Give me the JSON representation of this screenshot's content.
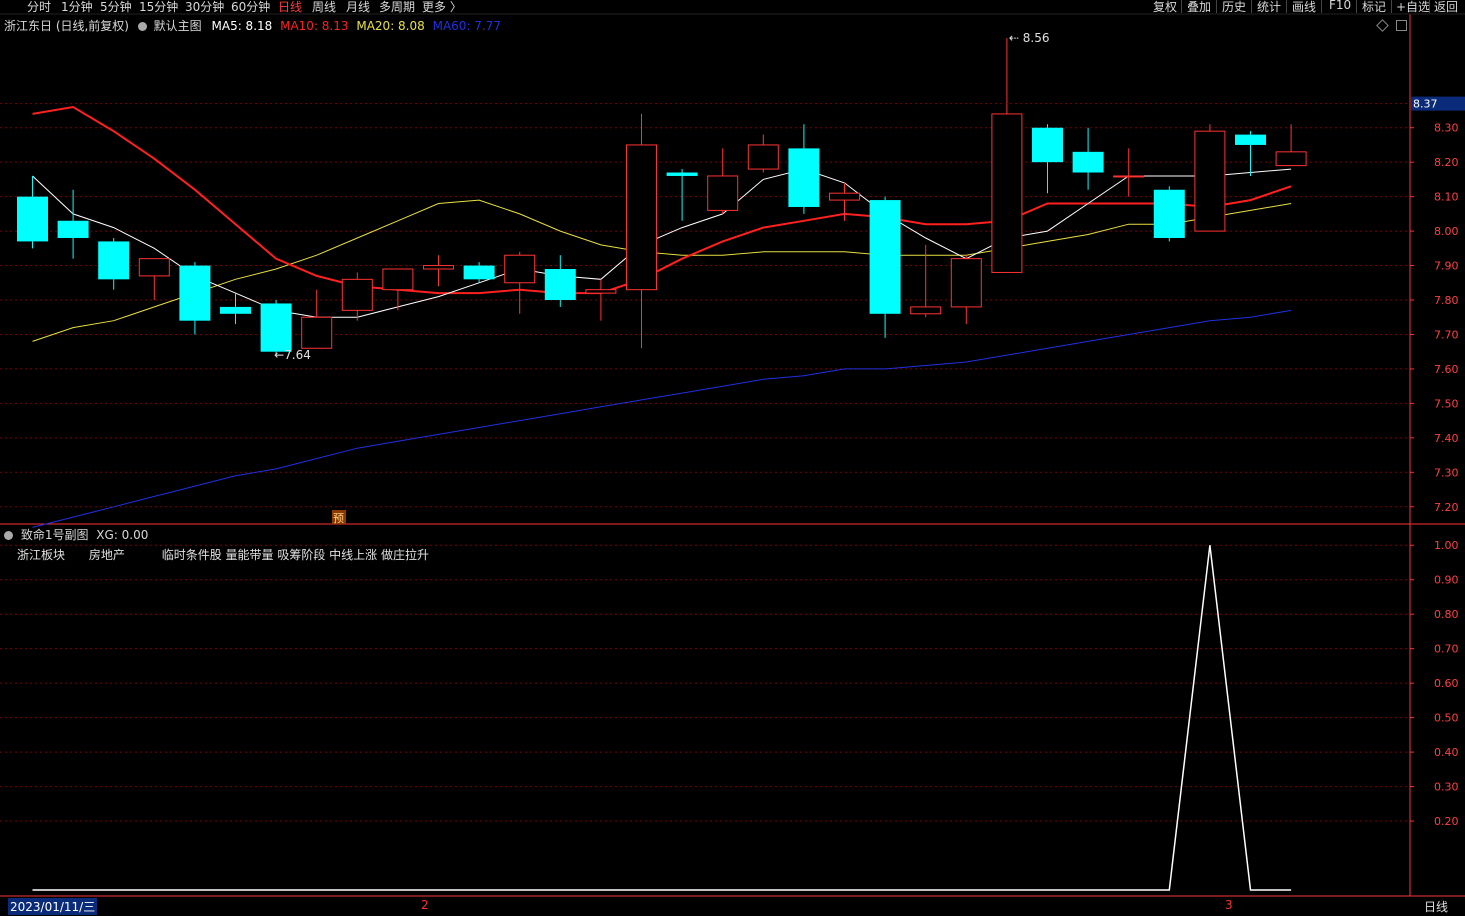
{
  "toolbar": {
    "periods": [
      "分时",
      "1分钟",
      "5分钟",
      "15分钟",
      "30分钟",
      "60分钟",
      "日线",
      "周线",
      "月线",
      "多周期",
      "更多 〉"
    ],
    "active_period": "日线",
    "right_buttons": [
      "复权",
      "叠加",
      "历史",
      "统计",
      "画线",
      "F10",
      "标记",
      "+自选",
      "返回"
    ]
  },
  "main_panel": {
    "title": "浙江东日 (日线,前复权)",
    "template": "默认主图",
    "ma": [
      {
        "label": "MA5: 8.18",
        "color": "#ffffff"
      },
      {
        "label": "MA10: 8.13",
        "color": "#ff2020"
      },
      {
        "label": "MA20: 8.08",
        "color": "#e8e040"
      },
      {
        "label": "MA60: 7.77",
        "color": "#2030e0"
      }
    ],
    "price_tag": "8.37",
    "max_label": "8.56",
    "min_label": "7.64",
    "forecast_marker": "预"
  },
  "sub_panel": {
    "title": "致命1号副图",
    "xg_label": "XG: 0.00",
    "sector1": "浙江板块",
    "sector2": "房地产",
    "tags": "临时条件股 量能带量 吸筹阶段 中线上涨 做庄拉升"
  },
  "bottom": {
    "date": "2023/01/11/三",
    "month_2": "2",
    "month_3": "3",
    "period_label": "日线"
  },
  "colors": {
    "up": "#ff3232",
    "down": "#00ffff",
    "grid": "#7a0000",
    "axis": "#ff3232",
    "ma5": "#ffffff",
    "ma10": "#ff2020",
    "ma20": "#e8e040",
    "ma60": "#2030e0"
  },
  "chart_data": {
    "type": "candlestick",
    "ylim": [
      7.15,
      8.63
    ],
    "yticks": [
      7.2,
      7.3,
      7.4,
      7.5,
      7.6,
      7.7,
      7.8,
      7.9,
      8.0,
      8.1,
      8.2,
      8.3
    ],
    "candles": [
      {
        "o": 8.1,
        "h": 8.16,
        "l": 7.95,
        "c": 7.97
      },
      {
        "o": 8.03,
        "h": 8.12,
        "l": 7.92,
        "c": 7.98
      },
      {
        "o": 7.97,
        "h": 7.98,
        "l": 7.83,
        "c": 7.86
      },
      {
        "o": 7.87,
        "h": 7.92,
        "l": 7.8,
        "c": 7.92
      },
      {
        "o": 7.9,
        "h": 7.91,
        "l": 7.7,
        "c": 7.74
      },
      {
        "o": 7.78,
        "h": 7.82,
        "l": 7.73,
        "c": 7.76
      },
      {
        "o": 7.79,
        "h": 7.8,
        "l": 7.64,
        "c": 7.65
      },
      {
        "o": 7.66,
        "h": 7.83,
        "l": 7.66,
        "c": 7.75
      },
      {
        "o": 7.77,
        "h": 7.88,
        "l": 7.74,
        "c": 7.86
      },
      {
        "o": 7.83,
        "h": 7.89,
        "l": 7.77,
        "c": 7.89
      },
      {
        "o": 7.89,
        "h": 7.93,
        "l": 7.84,
        "c": 7.9
      },
      {
        "o": 7.9,
        "h": 7.91,
        "l": 7.85,
        "c": 7.86
      },
      {
        "o": 7.85,
        "h": 7.94,
        "l": 7.76,
        "c": 7.93
      },
      {
        "o": 7.89,
        "h": 7.93,
        "l": 7.78,
        "c": 7.8
      },
      {
        "o": 7.82,
        "h": 7.86,
        "l": 7.74,
        "c": 7.83
      },
      {
        "o": 7.83,
        "h": 8.34,
        "l": 7.66,
        "c": 8.25
      },
      {
        "o": 8.17,
        "h": 8.18,
        "l": 8.03,
        "c": 8.16
      },
      {
        "o": 8.06,
        "h": 8.24,
        "l": 8.05,
        "c": 8.16
      },
      {
        "o": 8.18,
        "h": 8.28,
        "l": 8.17,
        "c": 8.25
      },
      {
        "o": 8.24,
        "h": 8.31,
        "l": 8.05,
        "c": 8.07
      },
      {
        "o": 8.09,
        "h": 8.14,
        "l": 8.03,
        "c": 8.11
      },
      {
        "o": 8.09,
        "h": 8.1,
        "l": 7.69,
        "c": 7.76
      },
      {
        "o": 7.76,
        "h": 7.96,
        "l": 7.75,
        "c": 7.78
      },
      {
        "o": 7.78,
        "h": 7.93,
        "l": 7.73,
        "c": 7.92
      },
      {
        "o": 7.88,
        "h": 8.56,
        "l": 7.88,
        "c": 8.34
      },
      {
        "o": 8.3,
        "h": 8.31,
        "l": 8.11,
        "c": 8.2
      },
      {
        "o": 8.23,
        "h": 8.3,
        "l": 8.12,
        "c": 8.17
      },
      {
        "o": 8.16,
        "h": 8.24,
        "l": 8.1,
        "c": 8.16
      },
      {
        "o": 8.12,
        "h": 8.13,
        "l": 7.97,
        "c": 7.98
      },
      {
        "o": 8.0,
        "h": 8.31,
        "l": 8.0,
        "c": 8.29
      },
      {
        "o": 8.28,
        "h": 8.29,
        "l": 8.16,
        "c": 8.25
      },
      {
        "o": 8.19,
        "h": 8.31,
        "l": 8.19,
        "c": 8.23
      }
    ],
    "ma5": [
      8.16,
      8.05,
      8.01,
      7.95,
      7.87,
      7.82,
      7.77,
      7.75,
      7.75,
      7.78,
      7.81,
      7.85,
      7.89,
      7.87,
      7.86,
      7.96,
      8.01,
      8.05,
      8.15,
      8.18,
      8.14,
      8.05,
      7.98,
      7.92,
      7.98,
      8.0,
      8.08,
      8.16,
      8.16,
      8.16,
      8.17,
      8.18
    ],
    "ma10": [
      8.34,
      8.36,
      8.29,
      8.21,
      8.12,
      8.02,
      7.92,
      7.87,
      7.84,
      7.83,
      7.82,
      7.82,
      7.83,
      7.82,
      7.82,
      7.86,
      7.92,
      7.97,
      8.01,
      8.03,
      8.05,
      8.04,
      8.02,
      8.02,
      8.03,
      8.08,
      8.08,
      8.08,
      8.08,
      8.07,
      8.09,
      8.13
    ],
    "ma20": [
      7.68,
      7.72,
      7.74,
      7.78,
      7.82,
      7.86,
      7.89,
      7.93,
      7.98,
      8.03,
      8.08,
      8.09,
      8.05,
      8.0,
      7.96,
      7.94,
      7.93,
      7.93,
      7.94,
      7.94,
      7.94,
      7.93,
      7.93,
      7.93,
      7.95,
      7.97,
      7.99,
      8.02,
      8.02,
      8.04,
      8.06,
      8.08
    ],
    "ma60": [
      7.14,
      7.17,
      7.2,
      7.23,
      7.26,
      7.29,
      7.31,
      7.34,
      7.37,
      7.39,
      7.41,
      7.43,
      7.45,
      7.47,
      7.49,
      7.51,
      7.53,
      7.55,
      7.57,
      7.58,
      7.6,
      7.6,
      7.61,
      7.62,
      7.64,
      7.66,
      7.68,
      7.7,
      7.72,
      7.74,
      7.75,
      7.77
    ],
    "sub_ylim": [
      0,
      1.05
    ],
    "sub_yticks": [
      0.2,
      0.3,
      0.4,
      0.5,
      0.6,
      0.7,
      0.8,
      0.9,
      1.0
    ],
    "xg": [
      0,
      0,
      0,
      0,
      0,
      0,
      0,
      0,
      0,
      0,
      0,
      0,
      0,
      0,
      0,
      0,
      0,
      0,
      0,
      0,
      0,
      0,
      0,
      0,
      0,
      0,
      0,
      0,
      0,
      1,
      0,
      0
    ]
  }
}
